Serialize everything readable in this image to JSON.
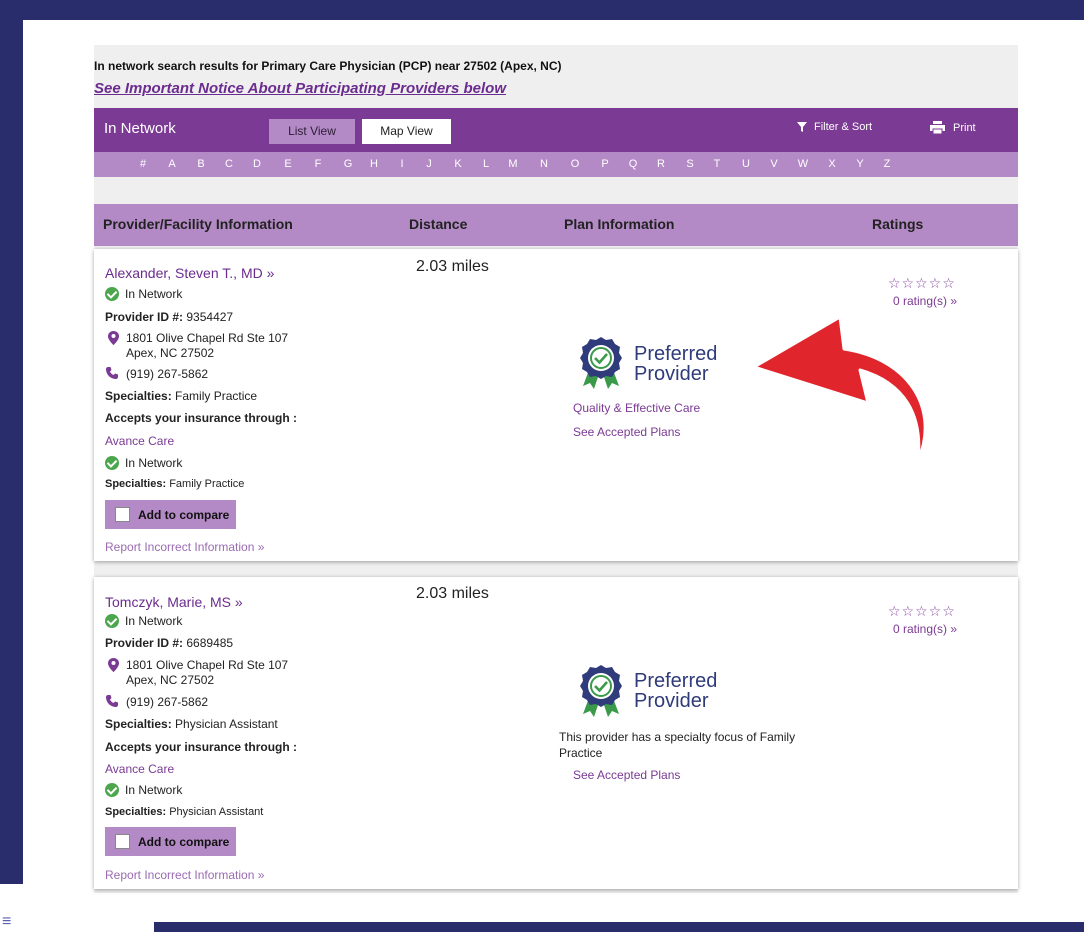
{
  "header": {
    "search_text": "In network search results for Primary Care Physician (PCP) near 27502 (Apex, NC)",
    "notice_link": "See Important Notice About Participating Providers below"
  },
  "toolbar": {
    "network_label": "In Network",
    "list_view": "List View",
    "map_view": "Map View",
    "filter_sort": "Filter & Sort",
    "print": "Print"
  },
  "alphabet": [
    "#",
    "A",
    "B",
    "C",
    "D",
    "E",
    "F",
    "G",
    "H",
    "I",
    "J",
    "K",
    "L",
    "M",
    "N",
    "O",
    "P",
    "Q",
    "R",
    "S",
    "T",
    "U",
    "V",
    "W",
    "X",
    "Y",
    "Z"
  ],
  "columns": {
    "provider": "Provider/Facility Information",
    "distance": "Distance",
    "plan": "Plan Information",
    "ratings": "Ratings"
  },
  "providers": [
    {
      "name": "Alexander, Steven T., MD »",
      "network_status": "In Network",
      "provider_id_label": "Provider ID #:",
      "provider_id": "9354427",
      "address_line1": "1801 Olive Chapel Rd Ste 107",
      "address_line2": "Apex, NC 27502",
      "phone": "(919) 267-5862",
      "specialties_label": "Specialties:",
      "specialties": "Family Practice",
      "accepts_label": "Accepts your insurance through :",
      "group": "Avance Care",
      "group_network_status": "In Network",
      "group_specialties_label": "Specialties:",
      "group_specialties": "Family Practice",
      "compare_label": "Add to compare",
      "report_link": "Report Incorrect Information  »",
      "distance": "2.03 miles",
      "preferred_line1": "Preferred",
      "preferred_line2": "Provider",
      "plan_note": "Quality & Effective Care",
      "plans_link": "See Accepted Plans",
      "stars": "☆☆☆☆☆",
      "ratings_link": "0 rating(s)  »"
    },
    {
      "name": "Tomczyk, Marie, MS »",
      "network_status": "In Network",
      "provider_id_label": "Provider ID #:",
      "provider_id": "6689485",
      "address_line1": "1801 Olive Chapel Rd Ste 107",
      "address_line2": "Apex, NC 27502",
      "phone": "(919) 267-5862",
      "specialties_label": "Specialties:",
      "specialties": "Physician Assistant",
      "accepts_label": "Accepts your insurance through :",
      "group": "Avance Care",
      "group_network_status": "In Network",
      "group_specialties_label": "Specialties:",
      "group_specialties": "Physician Assistant",
      "compare_label": "Add to compare",
      "report_link": "Report Incorrect Information  »",
      "distance": "2.03 miles",
      "preferred_line1": "Preferred",
      "preferred_line2": "Provider",
      "plan_note": "This provider has a specialty focus of Family Practice",
      "plans_link": "See Accepted Plans",
      "stars": "☆☆☆☆☆",
      "ratings_link": "0 rating(s)  »"
    }
  ],
  "colors": {
    "frame": "#2a2d6b",
    "purple_dark": "#7b3a93",
    "purple_light": "#b48ac6",
    "arrow_red": "#e0262c"
  }
}
